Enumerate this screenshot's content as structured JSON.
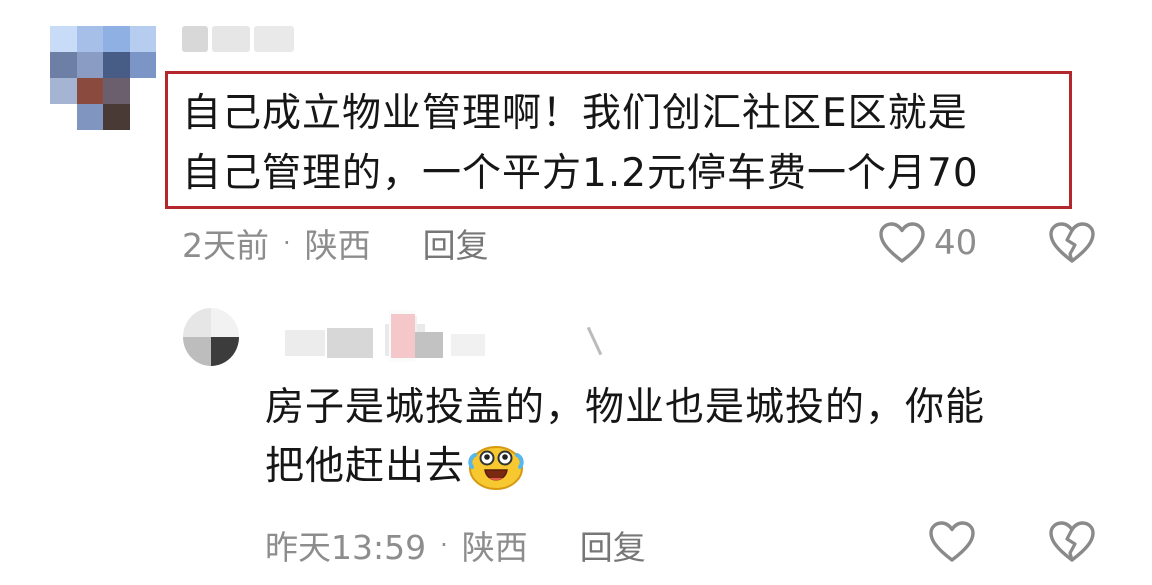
{
  "comments": [
    {
      "text_line1": "自己成立物业管理啊！我们创汇社区E区就是",
      "text_line2": "自己管理的，一个平方1.2元停车费一个月70",
      "time": "2天前",
      "separator": "·",
      "location": "陕西",
      "reply_label": "回复",
      "like_count": "40",
      "like_icon": "heart-outline-icon",
      "dislike_icon": "broken-heart-icon",
      "highlight_color": "#b3272d"
    },
    {
      "text_line1": "房子是城投盖的，物业也是城投的，你能",
      "text_line2": "把他赶出去",
      "emoji_icon": "crying-laughing-emoji",
      "time": "昨天13:59",
      "separator": "·",
      "location": "陕西",
      "reply_label": "回复",
      "like_icon": "heart-outline-icon",
      "dislike_icon": "broken-heart-icon"
    }
  ],
  "colors": {
    "text": "#161616",
    "meta": "#8d8d8d",
    "icon": "#8a8a8a"
  }
}
